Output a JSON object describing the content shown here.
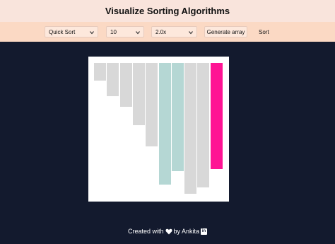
{
  "header": {
    "title": "Visualize Sorting Algorithms"
  },
  "toolbar": {
    "algorithm": "Quick Sort",
    "size": "10",
    "speed": "2.0x",
    "generate_label": "Generate array",
    "sort_label": "Sort"
  },
  "bars": {
    "values": [
      25,
      47,
      62,
      88,
      118,
      172,
      153,
      185,
      176,
      150
    ],
    "states": [
      "default",
      "default",
      "default",
      "default",
      "default",
      "sorted",
      "sorted",
      "default",
      "default",
      "pivot"
    ]
  },
  "colors": {
    "default": "#d8d8d8",
    "sorted": "#b5d7d4",
    "pivot": "#ff1494"
  },
  "footer": {
    "created_with": "Created with",
    "by": "by Ankita",
    "icons": [
      "heart-icon",
      "linkedin-icon"
    ]
  },
  "footer_li": "in"
}
